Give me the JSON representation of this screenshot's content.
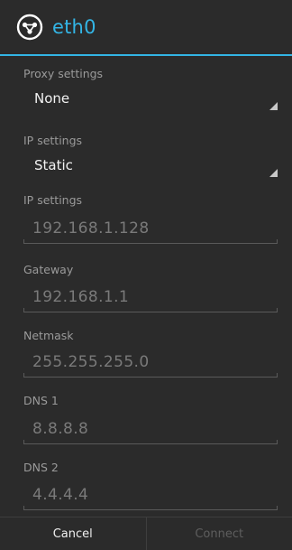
{
  "dialog": {
    "title": "eth0",
    "title_icon": "ethernet-icon",
    "accent_color": "#33b5e5"
  },
  "proxy": {
    "label": "Proxy settings",
    "value": "None"
  },
  "ip_mode": {
    "label": "IP settings",
    "value": "Static"
  },
  "fields": [
    {
      "label": "IP settings",
      "value": "192.168.1.128"
    },
    {
      "label": "Gateway",
      "value": "192.168.1.1"
    },
    {
      "label": "Netmask",
      "value": "255.255.255.0"
    },
    {
      "label": "DNS 1",
      "value": "8.8.8.8"
    },
    {
      "label": "DNS 2",
      "value": "4.4.4.4"
    }
  ],
  "buttons": {
    "cancel": "Cancel",
    "connect": "Connect"
  }
}
